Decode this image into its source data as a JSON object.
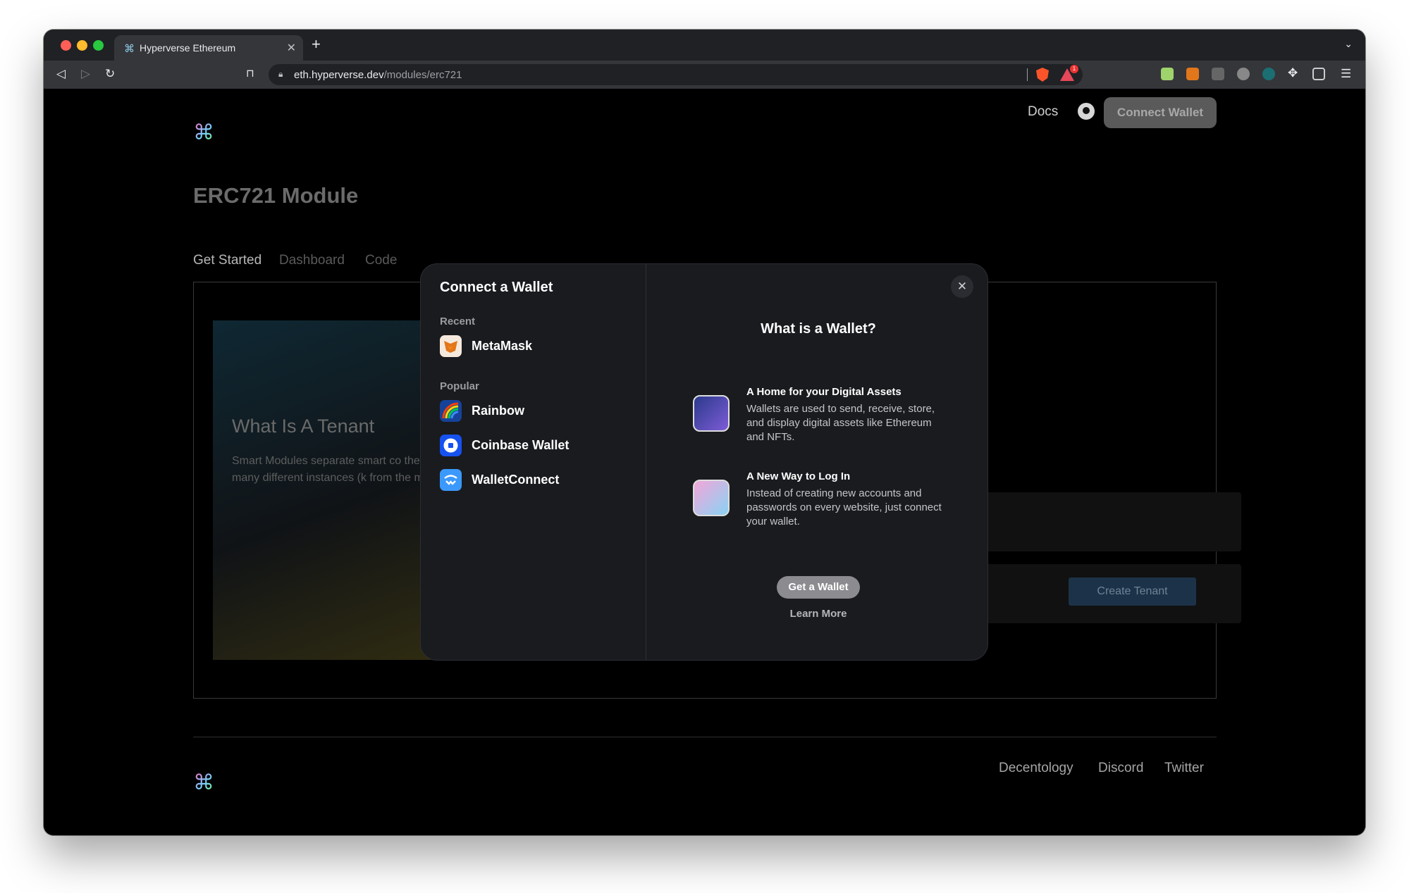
{
  "browser": {
    "tab_title": "Hyperverse Ethereum",
    "url_domain": "eth.hyperverse.dev",
    "url_path": "/modules/erc721",
    "rewards_badge": "1"
  },
  "header": {
    "docs": "Docs",
    "connect_wallet": "Connect Wallet"
  },
  "page": {
    "title": "ERC721 Module",
    "tabs": [
      "Get Started",
      "Dashboard",
      "Code"
    ],
    "tenant_title": "What Is A Tenant",
    "tenant_text": "Smart Modules separate smart co their associated data allowing ea clone many different instances (k from the main contract.",
    "create_tenant": "Create Tenant"
  },
  "footer": {
    "links": [
      "Decentology",
      "Discord",
      "Twitter"
    ]
  },
  "modal": {
    "title": "Connect a Wallet",
    "recent_label": "Recent",
    "recent": [
      {
        "label": "MetaMask",
        "icon": "metamask-icon"
      }
    ],
    "popular_label": "Popular",
    "popular": [
      {
        "label": "Rainbow",
        "icon": "rainbow-icon"
      },
      {
        "label": "Coinbase Wallet",
        "icon": "coinbase-icon"
      },
      {
        "label": "WalletConnect",
        "icon": "walletconnect-icon"
      }
    ],
    "close": "✕",
    "info_title": "What is a Wallet?",
    "info": [
      {
        "title": "A Home for your Digital Assets",
        "desc": "Wallets are used to send, receive, store, and display digital assets like Ethereum and NFTs."
      },
      {
        "title": "A New Way to Log In",
        "desc": "Instead of creating new accounts and passwords on every website, just connect your wallet."
      }
    ],
    "get_wallet": "Get a Wallet",
    "learn_more": "Learn More"
  }
}
